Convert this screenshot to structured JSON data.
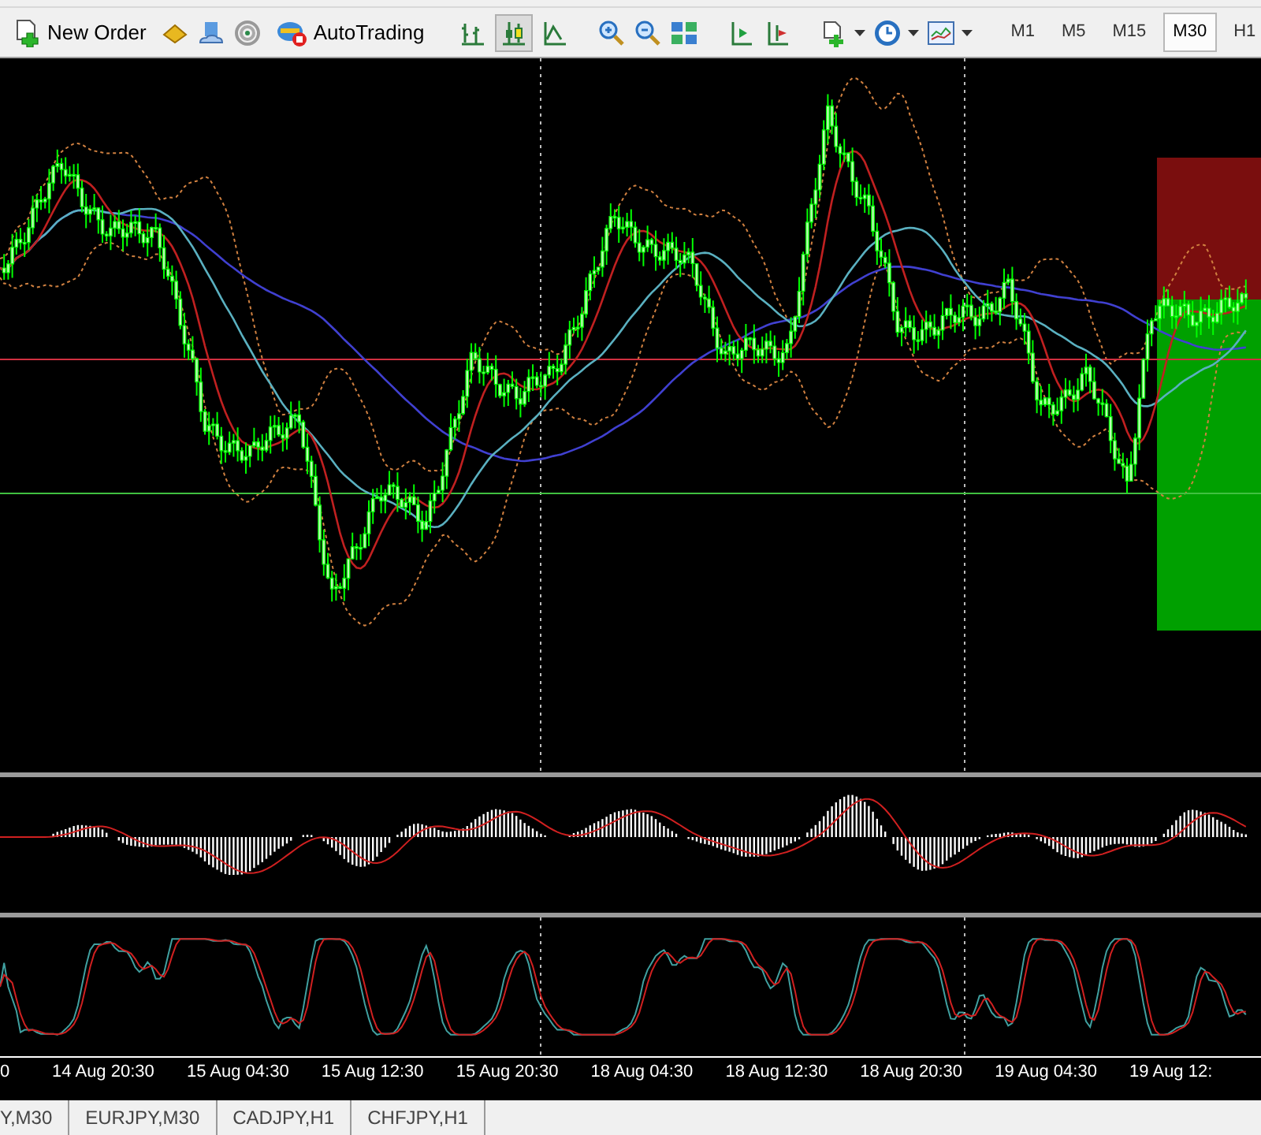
{
  "toolbar": {
    "new_order": "New Order",
    "auto_trading": "AutoTrading",
    "timeframes": [
      {
        "label": "M1",
        "selected": false
      },
      {
        "label": "M5",
        "selected": false
      },
      {
        "label": "M15",
        "selected": false
      },
      {
        "label": "M30",
        "selected": true
      },
      {
        "label": "H1",
        "selected": false
      }
    ]
  },
  "time_axis": [
    "0",
    "14 Aug 20:30",
    "15 Aug 04:30",
    "15 Aug 12:30",
    "15 Aug 20:30",
    "18 Aug 04:30",
    "18 Aug 12:30",
    "18 Aug 20:30",
    "19 Aug 04:30",
    "19 Aug 12:"
  ],
  "chart_tabs": [
    "Y,M30",
    "EURJPY,M30",
    "CADJPY,H1",
    "CHFJPY,H1"
  ]
}
